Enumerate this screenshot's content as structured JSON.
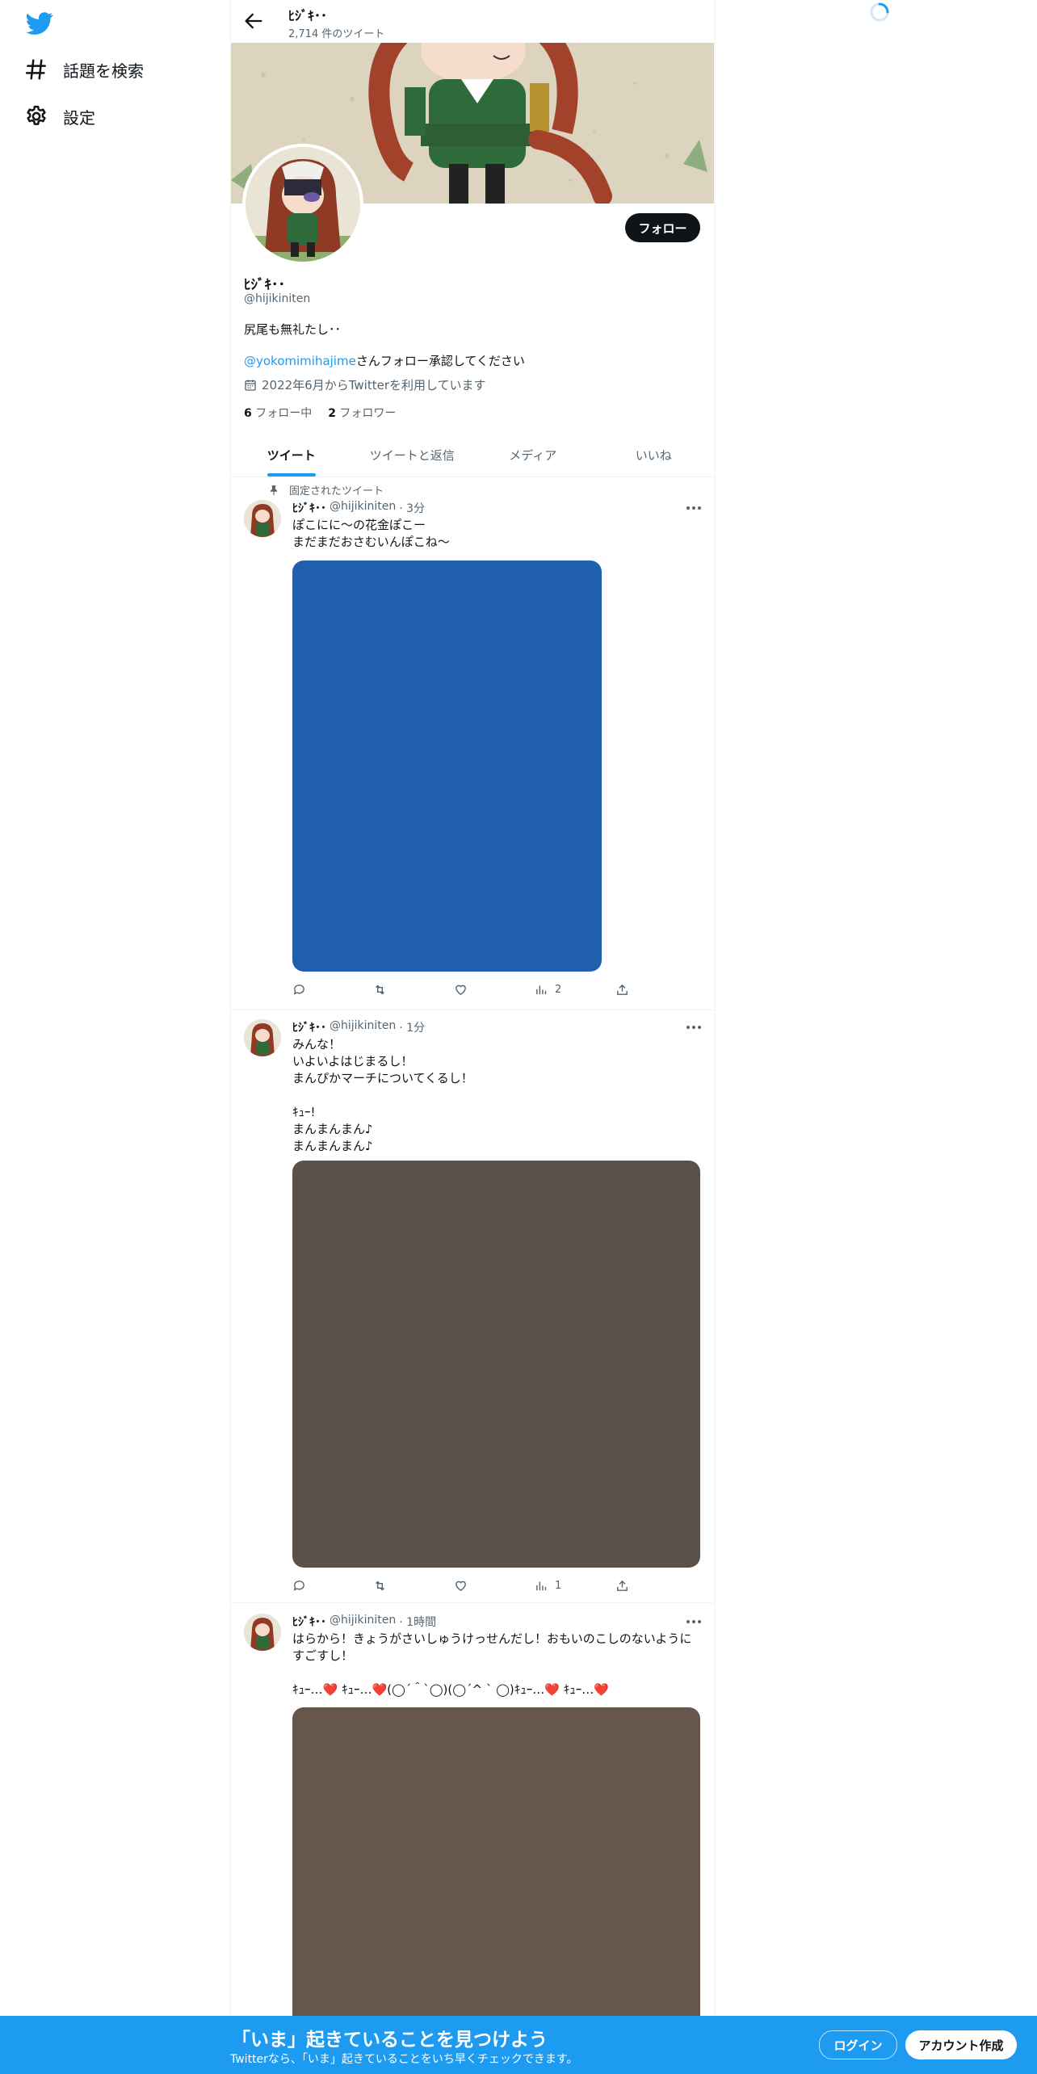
{
  "nav": {
    "logo_icon": "twitter-bird-icon",
    "items": [
      {
        "icon": "hashtag-icon",
        "label": "話題を検索"
      },
      {
        "icon": "gear-icon",
        "label": "設定"
      }
    ]
  },
  "header": {
    "name": "ﾋｼﾞｷ･･",
    "tweet_count": "2,714 件のツイート"
  },
  "profile": {
    "name": "ﾋｼﾞｷ･･",
    "handle": "@hijikiniten",
    "bio": "尻尾も無礼たし･･",
    "note_link": "@yokomimihajime",
    "note_rest": "さんフォロー承認してください",
    "joined": "2022年6月からTwitterを利用しています",
    "following_count": "6",
    "following_label": "フォロー中",
    "followers_count": "2",
    "followers_label": "フォロワー",
    "follow_button": "フォロー"
  },
  "tabs": [
    {
      "label": "ツイート",
      "active": true
    },
    {
      "label": "ツイートと返信",
      "active": false
    },
    {
      "label": "メディア",
      "active": false
    },
    {
      "label": "いいね",
      "active": false
    }
  ],
  "tweets": [
    {
      "pinned_label": "固定されたツイート",
      "name": "ﾋｼﾞｷ･･",
      "handle": "@hijikiniten",
      "time": "· 3分",
      "text": "ぽこにに～の花金ぽこー\nまだまだおさむいんぽこね～",
      "media_color": "#1f5fad",
      "views": "2"
    },
    {
      "name": "ﾋｼﾞｷ･･",
      "handle": "@hijikiniten",
      "time": "· 1分",
      "text": "みんな！\nいよいよはじまるし！\nまんぴかマーチについてくるし！\n\nｷｭｰ!\nまんまんまん♪\nまんまんまん♪",
      "media_color": "#5a514b",
      "views": "1"
    },
    {
      "name": "ﾋｼﾞｷ･･",
      "handle": "@hijikiniten",
      "time": "· 1時間",
      "text": "はらから！きょうがさいしゅうけっせんだし！おもいのこしのないようにすごすし！\n\nｷｭｰ…❤️ ｷｭｰ…❤️(◯´＾`◯)(◯´^ ` ◯)ｷｭｰ…❤️ ｷｭｰ…❤️",
      "media_color": "#66564c"
    }
  ],
  "bottom_bar": {
    "title": "「いま」起きていることを見つけよう",
    "subtitle": "Twitterなら、「いま」起きていることをいち早くチェックできます。",
    "login": "ログイン",
    "signup": "アカウント作成"
  }
}
